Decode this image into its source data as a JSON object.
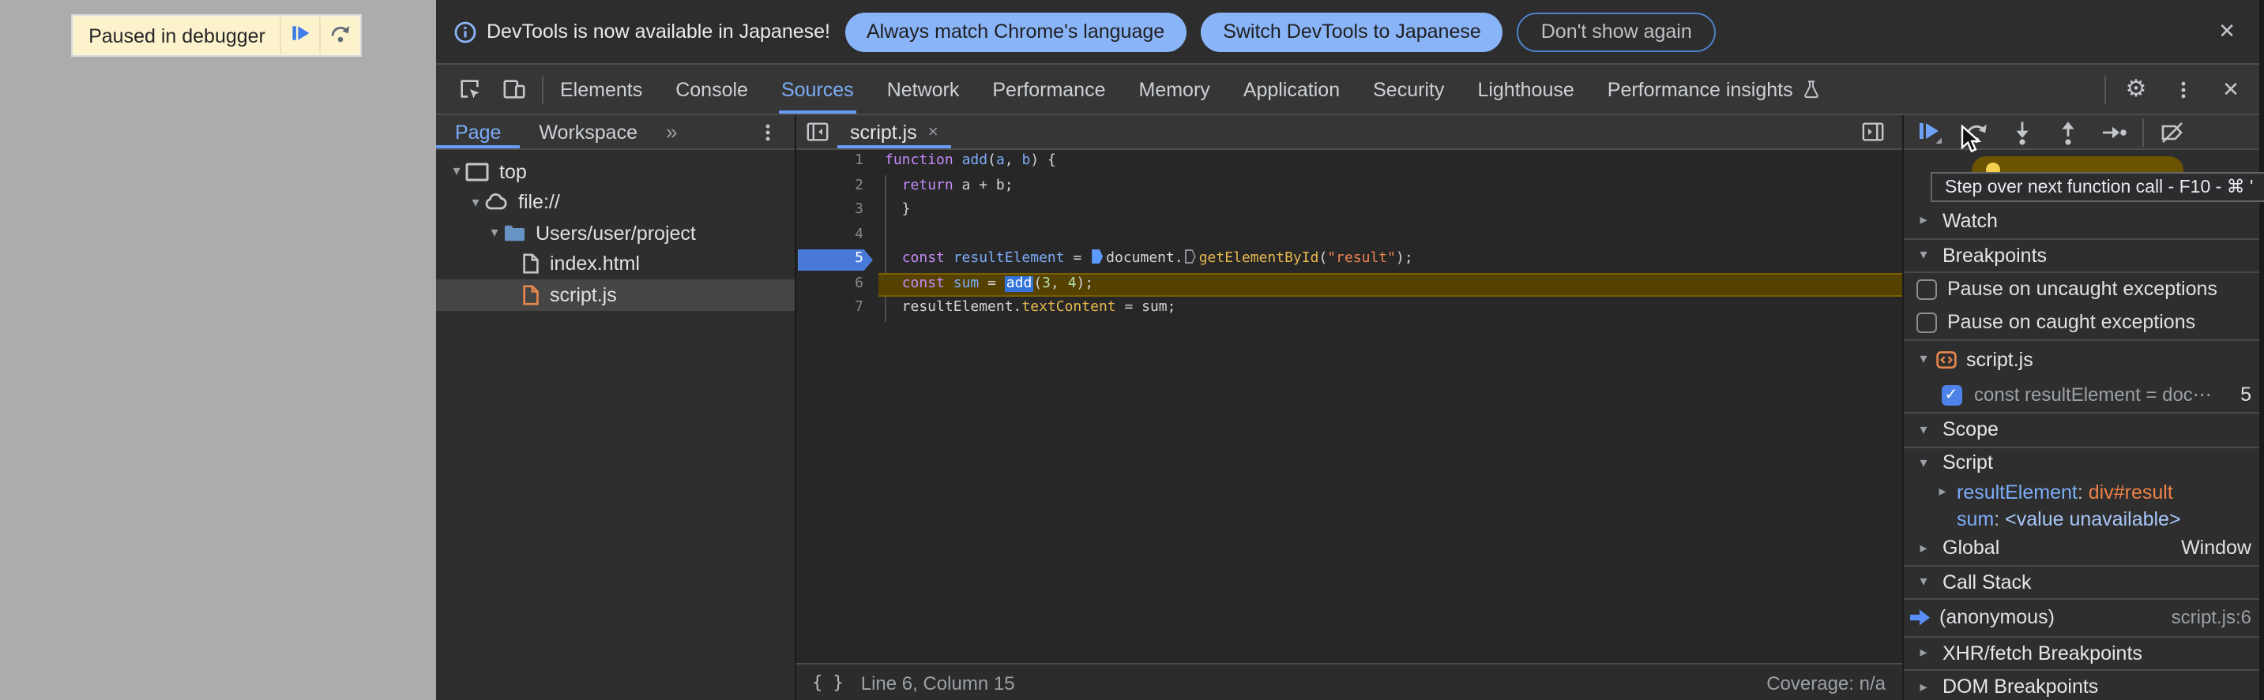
{
  "colors": {
    "accent_blue": "#669df6",
    "link_blue": "#7cacf8",
    "exec_line": "#554200",
    "breakpoint_blue": "#4879d9",
    "paused_banner_bg": "#fcf3cd",
    "button_blue": "#8ab4f8",
    "string_orange": "#ef8354",
    "property_gold": "#e7b94e",
    "keyword_purple": "#c58af9",
    "number_green": "#b9dfb2"
  },
  "page_overlay": {
    "banner": {
      "label": "Paused in debugger",
      "resume_icon": "resume-icon",
      "step_icon": "step-over-icon"
    }
  },
  "notification_bar": {
    "icon": "info-icon",
    "message": "DevTools is now available in Japanese!",
    "actions": [
      {
        "label": "Always match Chrome's language",
        "style": "filled"
      },
      {
        "label": "Switch DevTools to Japanese",
        "style": "filled"
      },
      {
        "label": "Don't show again",
        "style": "outlined"
      }
    ],
    "close_icon": "close-icon"
  },
  "main_toolbar": {
    "left_icons": [
      {
        "name": "inspect-icon"
      },
      {
        "name": "device-toolbar-icon"
      }
    ],
    "tabs": [
      {
        "label": "Elements"
      },
      {
        "label": "Console"
      },
      {
        "label": "Sources",
        "active": true
      },
      {
        "label": "Network"
      },
      {
        "label": "Performance"
      },
      {
        "label": "Memory"
      },
      {
        "label": "Application"
      },
      {
        "label": "Security"
      },
      {
        "label": "Lighthouse"
      },
      {
        "label": "Performance insights",
        "icon": "flask-icon"
      }
    ],
    "right_icons": [
      {
        "name": "gear-icon"
      },
      {
        "name": "kebab-icon"
      },
      {
        "name": "close-icon"
      }
    ]
  },
  "navigator": {
    "tabs": [
      {
        "label": "Page",
        "active": true
      },
      {
        "label": "Workspace"
      }
    ],
    "more_tabs": "»",
    "menu_icon": "kebab-icon",
    "tree": [
      {
        "label": "top",
        "icon": "frame-icon",
        "depth": 0,
        "expanded": true
      },
      {
        "label": "file://",
        "icon": "cloud-icon",
        "depth": 1,
        "expanded": true
      },
      {
        "label": "Users/user/project",
        "icon": "folder-icon",
        "depth": 2,
        "expanded": true
      },
      {
        "label": "index.html",
        "icon": "file-icon",
        "depth": 3
      },
      {
        "label": "script.js",
        "icon": "file-orange-icon",
        "depth": 3,
        "selected": true
      }
    ]
  },
  "editor": {
    "hide_navigator_icon": "panel-left-icon",
    "toggle_debugger_icon": "panel-right-icon",
    "tab": {
      "label": "script.js",
      "close": "×"
    },
    "lines": [
      {
        "num": "1",
        "tokens": [
          [
            "kw",
            "function"
          ],
          [
            "pl",
            " "
          ],
          [
            "fn",
            "add"
          ],
          [
            "pl",
            "("
          ],
          [
            "var",
            "a"
          ],
          [
            "pl",
            ", "
          ],
          [
            "var",
            "b"
          ],
          [
            "pl",
            ") {"
          ]
        ]
      },
      {
        "num": "2",
        "tokens": [
          [
            "pl",
            "  "
          ],
          [
            "kw",
            "return"
          ],
          [
            "pl",
            " a + b;"
          ]
        ]
      },
      {
        "num": "3",
        "tokens": [
          [
            "pl",
            "  }"
          ]
        ]
      },
      {
        "num": "4",
        "tokens": []
      },
      {
        "num": "5",
        "breakpoint": true,
        "tokens": [
          [
            "pl",
            "  "
          ],
          [
            "kw",
            "const"
          ],
          [
            "pl",
            " "
          ],
          [
            "var",
            "resultElement"
          ],
          [
            "pl",
            " = "
          ],
          [
            "mk",
            ""
          ],
          [
            "pl",
            "document."
          ],
          [
            "mko",
            ""
          ],
          [
            "prop",
            "getElementById"
          ],
          [
            "pl",
            "("
          ],
          [
            "str",
            "\"result\""
          ],
          [
            "pl",
            ");"
          ]
        ]
      },
      {
        "num": "6",
        "exec": true,
        "tokens": [
          [
            "pl",
            "  "
          ],
          [
            "kw",
            "const"
          ],
          [
            "pl",
            " "
          ],
          [
            "var",
            "sum"
          ],
          [
            "pl",
            " = "
          ],
          [
            "sel",
            "add"
          ],
          [
            "pl",
            "("
          ],
          [
            "num",
            "3"
          ],
          [
            "pl",
            ", "
          ],
          [
            "num",
            "4"
          ],
          [
            "pl",
            ");"
          ]
        ]
      },
      {
        "num": "7",
        "tokens": [
          [
            "pl",
            "  resultElement."
          ],
          [
            "prop",
            "textContent"
          ],
          [
            "pl",
            " = sum;"
          ]
        ]
      }
    ],
    "status_bar": {
      "pretty_print": "{ }",
      "position": "Line 6, Column 15",
      "coverage": "Coverage: n/a"
    }
  },
  "debugger_panel": {
    "toolbar_icons": [
      {
        "name": "resume-icon",
        "label": "resume"
      },
      {
        "name": "step-over-icon",
        "label": "step-over",
        "hovered": true
      },
      {
        "name": "step-into-icon",
        "label": "step-into"
      },
      {
        "name": "step-out-icon",
        "label": "step-out"
      },
      {
        "name": "step-icon",
        "label": "step"
      },
      {
        "name": "separator"
      },
      {
        "name": "deactivate-breakpoints-icon",
        "label": "deactivate-breakpoints"
      }
    ],
    "paused_toast": {
      "visible": true
    },
    "tooltip": {
      "text": "Step over next function call - F10 - ⌘ '"
    },
    "sections": [
      {
        "type": "header",
        "label": "Watch",
        "collapsed": true
      },
      {
        "type": "header",
        "label": "Breakpoints",
        "collapsed": false,
        "bt": true
      },
      {
        "type": "checkbox",
        "label": "Pause on uncaught exceptions",
        "checked": false,
        "bt": true
      },
      {
        "type": "checkbox",
        "label": "Pause on caught exceptions",
        "checked": false
      },
      {
        "type": "group",
        "label": "script.js",
        "icon": "script-file-icon",
        "bt": true
      },
      {
        "type": "breakpoint",
        "label": "const resultElement = doc⋯",
        "line": "5",
        "checked": true
      },
      {
        "type": "header",
        "label": "Scope",
        "collapsed": false,
        "bt": true
      },
      {
        "type": "scope-top",
        "label": "Script",
        "collapsed": false,
        "bt": true
      },
      {
        "type": "scope-var",
        "name": "resultElement",
        "value": "div#result",
        "value_color": "orange",
        "arrow": true
      },
      {
        "type": "scope-var",
        "name": "sum",
        "value": "<value unavailable>",
        "value_color": "blue",
        "arrow": false
      },
      {
        "type": "scope-top",
        "label": "Global",
        "collapsed": true,
        "right": "Window"
      },
      {
        "type": "header",
        "label": "Call Stack",
        "collapsed": false,
        "bt": true
      },
      {
        "type": "callstack",
        "label": "(anonymous)",
        "right": "script.js:6",
        "bt": true
      },
      {
        "type": "header",
        "label": "XHR/fetch Breakpoints",
        "collapsed": true,
        "bt": true
      },
      {
        "type": "header",
        "label": "DOM Breakpoints",
        "collapsed": true,
        "bt": true
      }
    ]
  }
}
